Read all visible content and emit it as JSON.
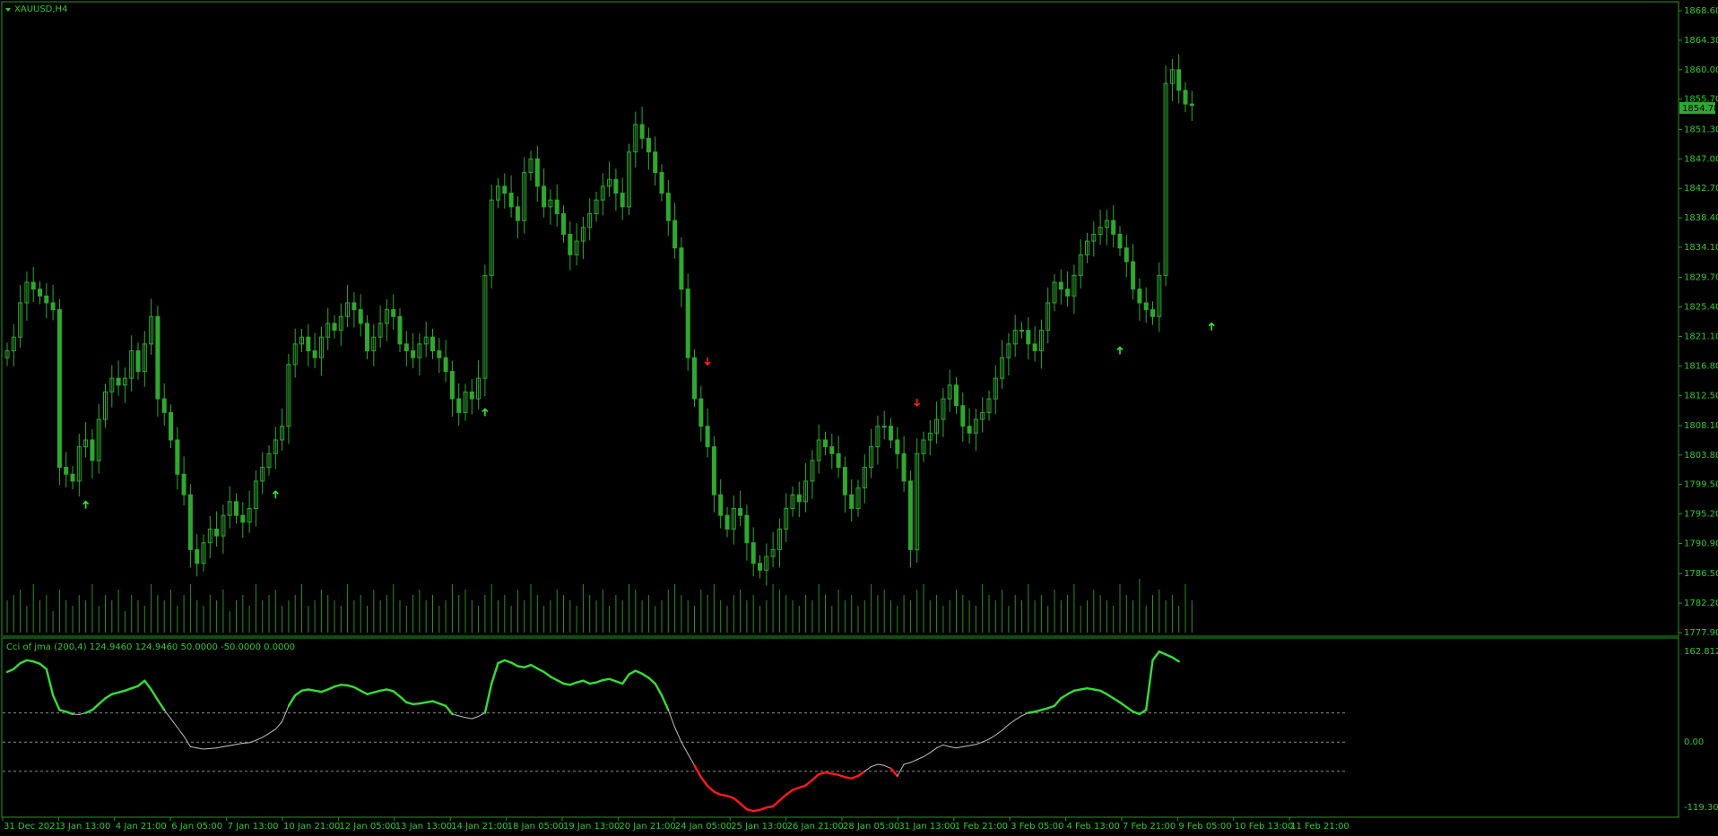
{
  "main_chart": {
    "symbol_label": "XAUUSD,H4",
    "current_price": "1854.78",
    "price_ticks": [
      "1868.60",
      "1864.30",
      "1860.00",
      "1855.70",
      "1851.30",
      "1847.00",
      "1842.70",
      "1838.40",
      "1834.10",
      "1829.70",
      "1825.40",
      "1821.10",
      "1816.80",
      "1812.50",
      "1808.10",
      "1803.80",
      "1799.50",
      "1795.20",
      "1790.90",
      "1786.50",
      "1782.20",
      "1777.90"
    ]
  },
  "indicator": {
    "label": "Cci of jma (200,4) 124.9460 124.9460 50.0000 -50.0000 0.0000",
    "ticks": [
      "162.8122",
      "0.00",
      "-119.3015"
    ]
  },
  "time_labels": [
    "31 Dec 2021",
    "3 Jan 13:00",
    "4 Jan 21:00",
    "6 Jan 05:00",
    "7 Jan 13:00",
    "10 Jan 21:00",
    "12 Jan 05:00",
    "13 Jan 13:00",
    "14 Jan 21:00",
    "18 Jan 05:00",
    "19 Jan 13:00",
    "20 Jan 21:00",
    "24 Jan 05:00",
    "25 Jan 13:00",
    "26 Jan 21:00",
    "28 Jan 05:00",
    "31 Jan 13:00",
    "1 Feb 21:00",
    "3 Feb 05:00",
    "4 Feb 13:00",
    "7 Feb 21:00",
    "9 Feb 05:00",
    "10 Feb 13:00",
    "11 Feb 21:00"
  ],
  "chart_data": {
    "type": "candlestick",
    "symbol": "XAUUSD",
    "timeframe": "H4",
    "ylim": [
      1777.9,
      1868.6
    ],
    "closes": [
      1819,
      1821,
      1826,
      1829,
      1828,
      1827,
      1826,
      1825,
      1802,
      1801,
      1800,
      1805,
      1806,
      1803,
      1809,
      1813,
      1815,
      1814,
      1815,
      1819,
      1816,
      1820,
      1824,
      1812,
      1810,
      1806,
      1801,
      1798,
      1790,
      1788,
      1791,
      1793,
      1792,
      1795,
      1797,
      1795,
      1794,
      1796,
      1800,
      1802,
      1804,
      1806,
      1808,
      1817,
      1820,
      1821,
      1819,
      1818,
      1821,
      1823,
      1822,
      1824,
      1826,
      1825,
      1823,
      1819,
      1821,
      1823,
      1825,
      1824,
      1820,
      1819,
      1818,
      1820,
      1821,
      1819,
      1818,
      1816,
      1812,
      1810,
      1813,
      1812,
      1815,
      1830,
      1841,
      1843,
      1842,
      1840,
      1838,
      1845,
      1847,
      1843,
      1840,
      1841,
      1839,
      1836,
      1833,
      1835,
      1837,
      1839,
      1841,
      1843,
      1844,
      1842,
      1840,
      1848,
      1852,
      1850,
      1848,
      1845,
      1842,
      1838,
      1834,
      1828,
      1818,
      1812,
      1808,
      1805,
      1798,
      1795,
      1793,
      1796,
      1795,
      1791,
      1788,
      1787,
      1789,
      1790,
      1793,
      1796,
      1798,
      1797,
      1800,
      1803,
      1806,
      1805,
      1804,
      1802,
      1798,
      1796,
      1799,
      1802,
      1805,
      1808,
      1808,
      1806,
      1804,
      1800,
      1790,
      1804,
      1806,
      1807,
      1809,
      1812,
      1814,
      1811,
      1808,
      1807,
      1809,
      1810,
      1812,
      1815,
      1818,
      1820,
      1822,
      1822,
      1820,
      1819,
      1822,
      1826,
      1829,
      1828,
      1827,
      1830,
      1833,
      1835,
      1836,
      1837,
      1838,
      1836,
      1834,
      1832,
      1828,
      1826,
      1825,
      1824,
      1830,
      1858,
      1860,
      1857,
      1855,
      1854.78
    ],
    "volumes": [
      0.6,
      0.7,
      0.8,
      0.5,
      0.9,
      0.6,
      0.7,
      0.4,
      0.8,
      0.6,
      0.5,
      0.7,
      0.6,
      0.9,
      0.5,
      0.7,
      0.6,
      0.8,
      0.4,
      0.7,
      0.6,
      0.5,
      0.9,
      0.7,
      0.6,
      0.8,
      0.5,
      0.7,
      0.9,
      0.6,
      0.5,
      0.7,
      0.6,
      0.8,
      0.4,
      0.6,
      0.7,
      0.5,
      0.9,
      0.6,
      0.7,
      0.8,
      0.5,
      0.6,
      0.7,
      0.9,
      0.5,
      0.6,
      0.8,
      0.7,
      0.6,
      0.5,
      0.9,
      0.6,
      0.7,
      0.5,
      0.8,
      0.6,
      0.7,
      0.9,
      0.6,
      0.5,
      0.7,
      0.8,
      0.6,
      0.7,
      0.5,
      0.6,
      0.9,
      0.7,
      0.8,
      0.6,
      0.5,
      0.7,
      0.9,
      0.6,
      0.7,
      0.5,
      0.8,
      0.6,
      0.9,
      0.7,
      0.5,
      0.6,
      0.8,
      0.7,
      0.6,
      0.5,
      0.9,
      0.7,
      0.6,
      0.8,
      0.5,
      0.7,
      0.6,
      0.9,
      0.8,
      0.6,
      0.7,
      0.5,
      0.6,
      0.8,
      0.9,
      0.7,
      0.6,
      0.5,
      0.8,
      0.7,
      0.9,
      0.6,
      0.5,
      0.7,
      0.8,
      0.6,
      0.7,
      0.5,
      0.6,
      0.9,
      0.8,
      0.7,
      0.6,
      0.5,
      0.7,
      0.6,
      0.9,
      0.7,
      0.5,
      0.8,
      0.6,
      0.7,
      0.5,
      0.6,
      0.9,
      0.7,
      0.8,
      0.6,
      0.5,
      0.7,
      0.6,
      0.8,
      0.9,
      0.6,
      0.7,
      0.5,
      0.6,
      0.8,
      0.7,
      0.6,
      0.5,
      0.9,
      0.7,
      0.6,
      0.8,
      0.5,
      0.7,
      0.6,
      0.9,
      0.6,
      0.7,
      0.5,
      0.8,
      0.6,
      0.7,
      0.9,
      0.5,
      0.6,
      0.8,
      0.7,
      0.6,
      0.5,
      0.9,
      0.7,
      0.6,
      1.0,
      0.5,
      0.7,
      0.8,
      0.6,
      0.7,
      0.5,
      0.9,
      0.6,
      0.7,
      1.0,
      0.8,
      0.6,
      0.7,
      0.5,
      0.6
    ],
    "cci": [
      120,
      125,
      135,
      140,
      138,
      134,
      125,
      80,
      55,
      52,
      48,
      47,
      50,
      55,
      65,
      75,
      82,
      85,
      88,
      92,
      96,
      105,
      90,
      72,
      55,
      40,
      25,
      10,
      -8,
      -10,
      -12,
      -11,
      -10,
      -8,
      -6,
      -4,
      -2,
      -1,
      3,
      8,
      15,
      22,
      35,
      62,
      80,
      88,
      90,
      88,
      86,
      90,
      95,
      98,
      97,
      94,
      88,
      82,
      85,
      88,
      90,
      87,
      78,
      68,
      65,
      66,
      68,
      70,
      66,
      62,
      48,
      45,
      42,
      40,
      44,
      50,
      100,
      135,
      140,
      136,
      130,
      128,
      132,
      126,
      120,
      112,
      106,
      100,
      98,
      102,
      105,
      100,
      102,
      106,
      108,
      104,
      100,
      116,
      122,
      117,
      110,
      100,
      80,
      55,
      25,
      0,
      -20,
      -40,
      -60,
      -75,
      -85,
      -90,
      -92,
      -96,
      -105,
      -115,
      -118,
      -116,
      -112,
      -110,
      -100,
      -90,
      -82,
      -78,
      -74,
      -65,
      -55,
      -52,
      -54,
      -56,
      -60,
      -62,
      -58,
      -50,
      -42,
      -38,
      -40,
      -45,
      -58,
      -38,
      -35,
      -30,
      -25,
      -18,
      -10,
      -5,
      -8,
      -10,
      -8,
      -6,
      -4,
      0,
      5,
      12,
      20,
      30,
      38,
      45,
      50,
      52,
      55,
      58,
      62,
      75,
      82,
      88,
      90,
      92,
      90,
      88,
      82,
      75,
      68,
      60,
      52,
      48,
      55,
      140,
      155,
      150,
      145,
      138
    ]
  },
  "signal_arrows": [
    {
      "index": 12,
      "direction": "up",
      "price": 1796.5,
      "color": "#2ee62e"
    },
    {
      "index": 41,
      "direction": "up",
      "price": 1798,
      "color": "#2ee62e"
    },
    {
      "index": 73,
      "direction": "up",
      "price": 1810,
      "color": "#2ee62e"
    },
    {
      "index": 107,
      "direction": "down",
      "price": 1817.5,
      "color": "#ff2020"
    },
    {
      "index": 139,
      "direction": "down",
      "price": 1811.5,
      "color": "#ff2020"
    },
    {
      "index": 170,
      "direction": "up",
      "price": 1819,
      "color": "#2ee62e"
    },
    {
      "index": 184,
      "direction": "up",
      "price": 1822.5,
      "color": "#2ee62e"
    }
  ],
  "colors": {
    "background": "#000000",
    "candle_body": "#2fa82f",
    "axis_text": "#32c832",
    "frame": "#1f9a1f",
    "volume": "#2a8c2a",
    "cci_up": "#36dd36",
    "cci_down": "#ff1a1a",
    "cci_neutral": "#bfbfbf",
    "level_line": "#8a8a8a",
    "price_badge_bg": "#2fa82f",
    "price_badge_fg": "#000000"
  }
}
